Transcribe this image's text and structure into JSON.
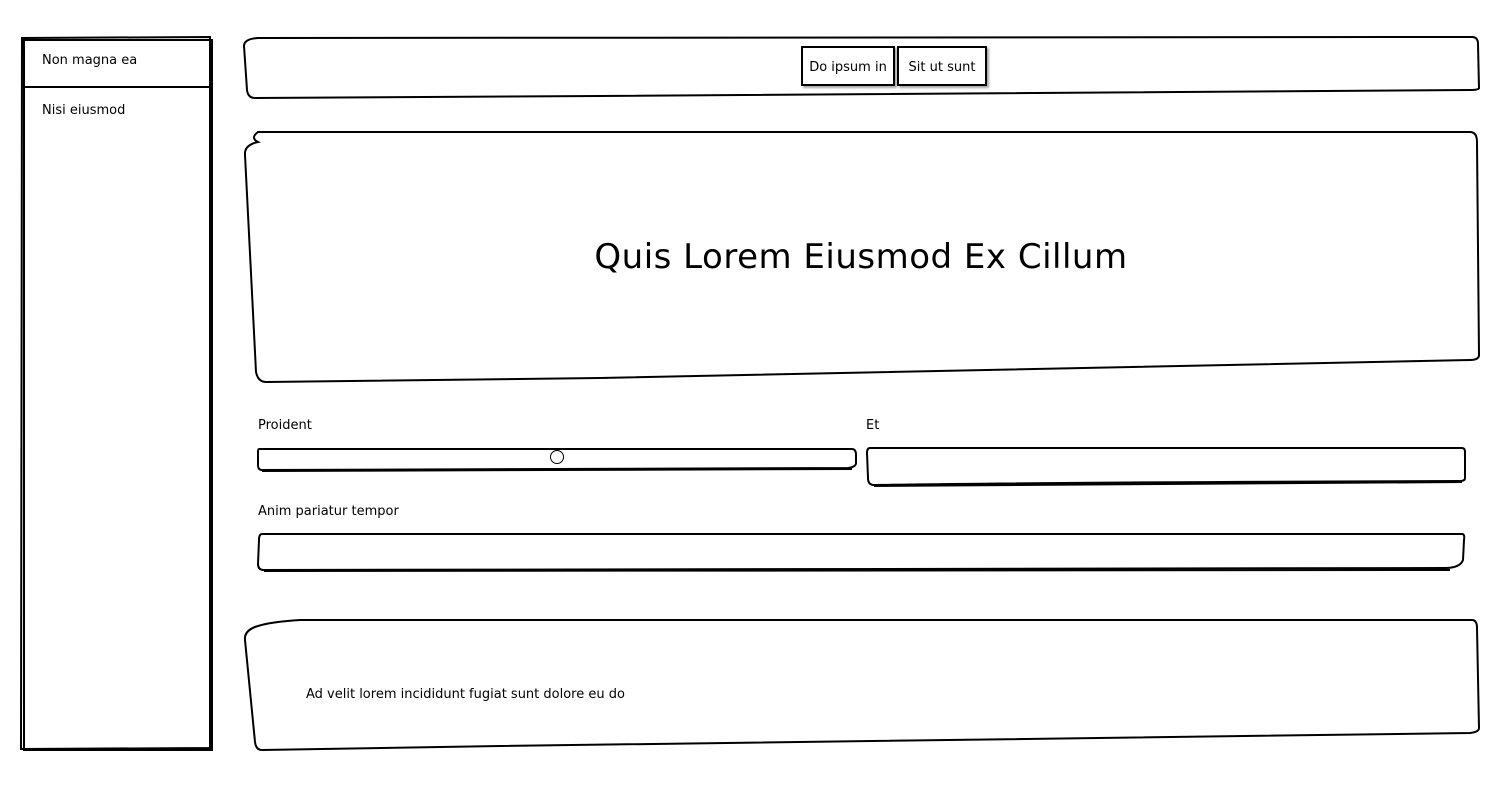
{
  "sidebar": {
    "items": [
      {
        "label": "Non magna ea"
      },
      {
        "label": "Nisi eiusmod"
      }
    ]
  },
  "nav": {
    "buttons": [
      {
        "label": "Do ipsum in"
      },
      {
        "label": "Sit ut sunt"
      }
    ]
  },
  "hero": {
    "title": "Quis Lorem Eiusmod Ex Cillum"
  },
  "form": {
    "slider": {
      "label": "Proident",
      "value_fraction": 0.5
    },
    "field_et": {
      "label": "Et",
      "value": "",
      "placeholder": ""
    },
    "field_anim": {
      "label": "Anim pariatur tempor",
      "value": "",
      "placeholder": ""
    }
  },
  "footer": {
    "text": "Ad velit lorem incididunt fugiat sunt dolore eu do"
  }
}
